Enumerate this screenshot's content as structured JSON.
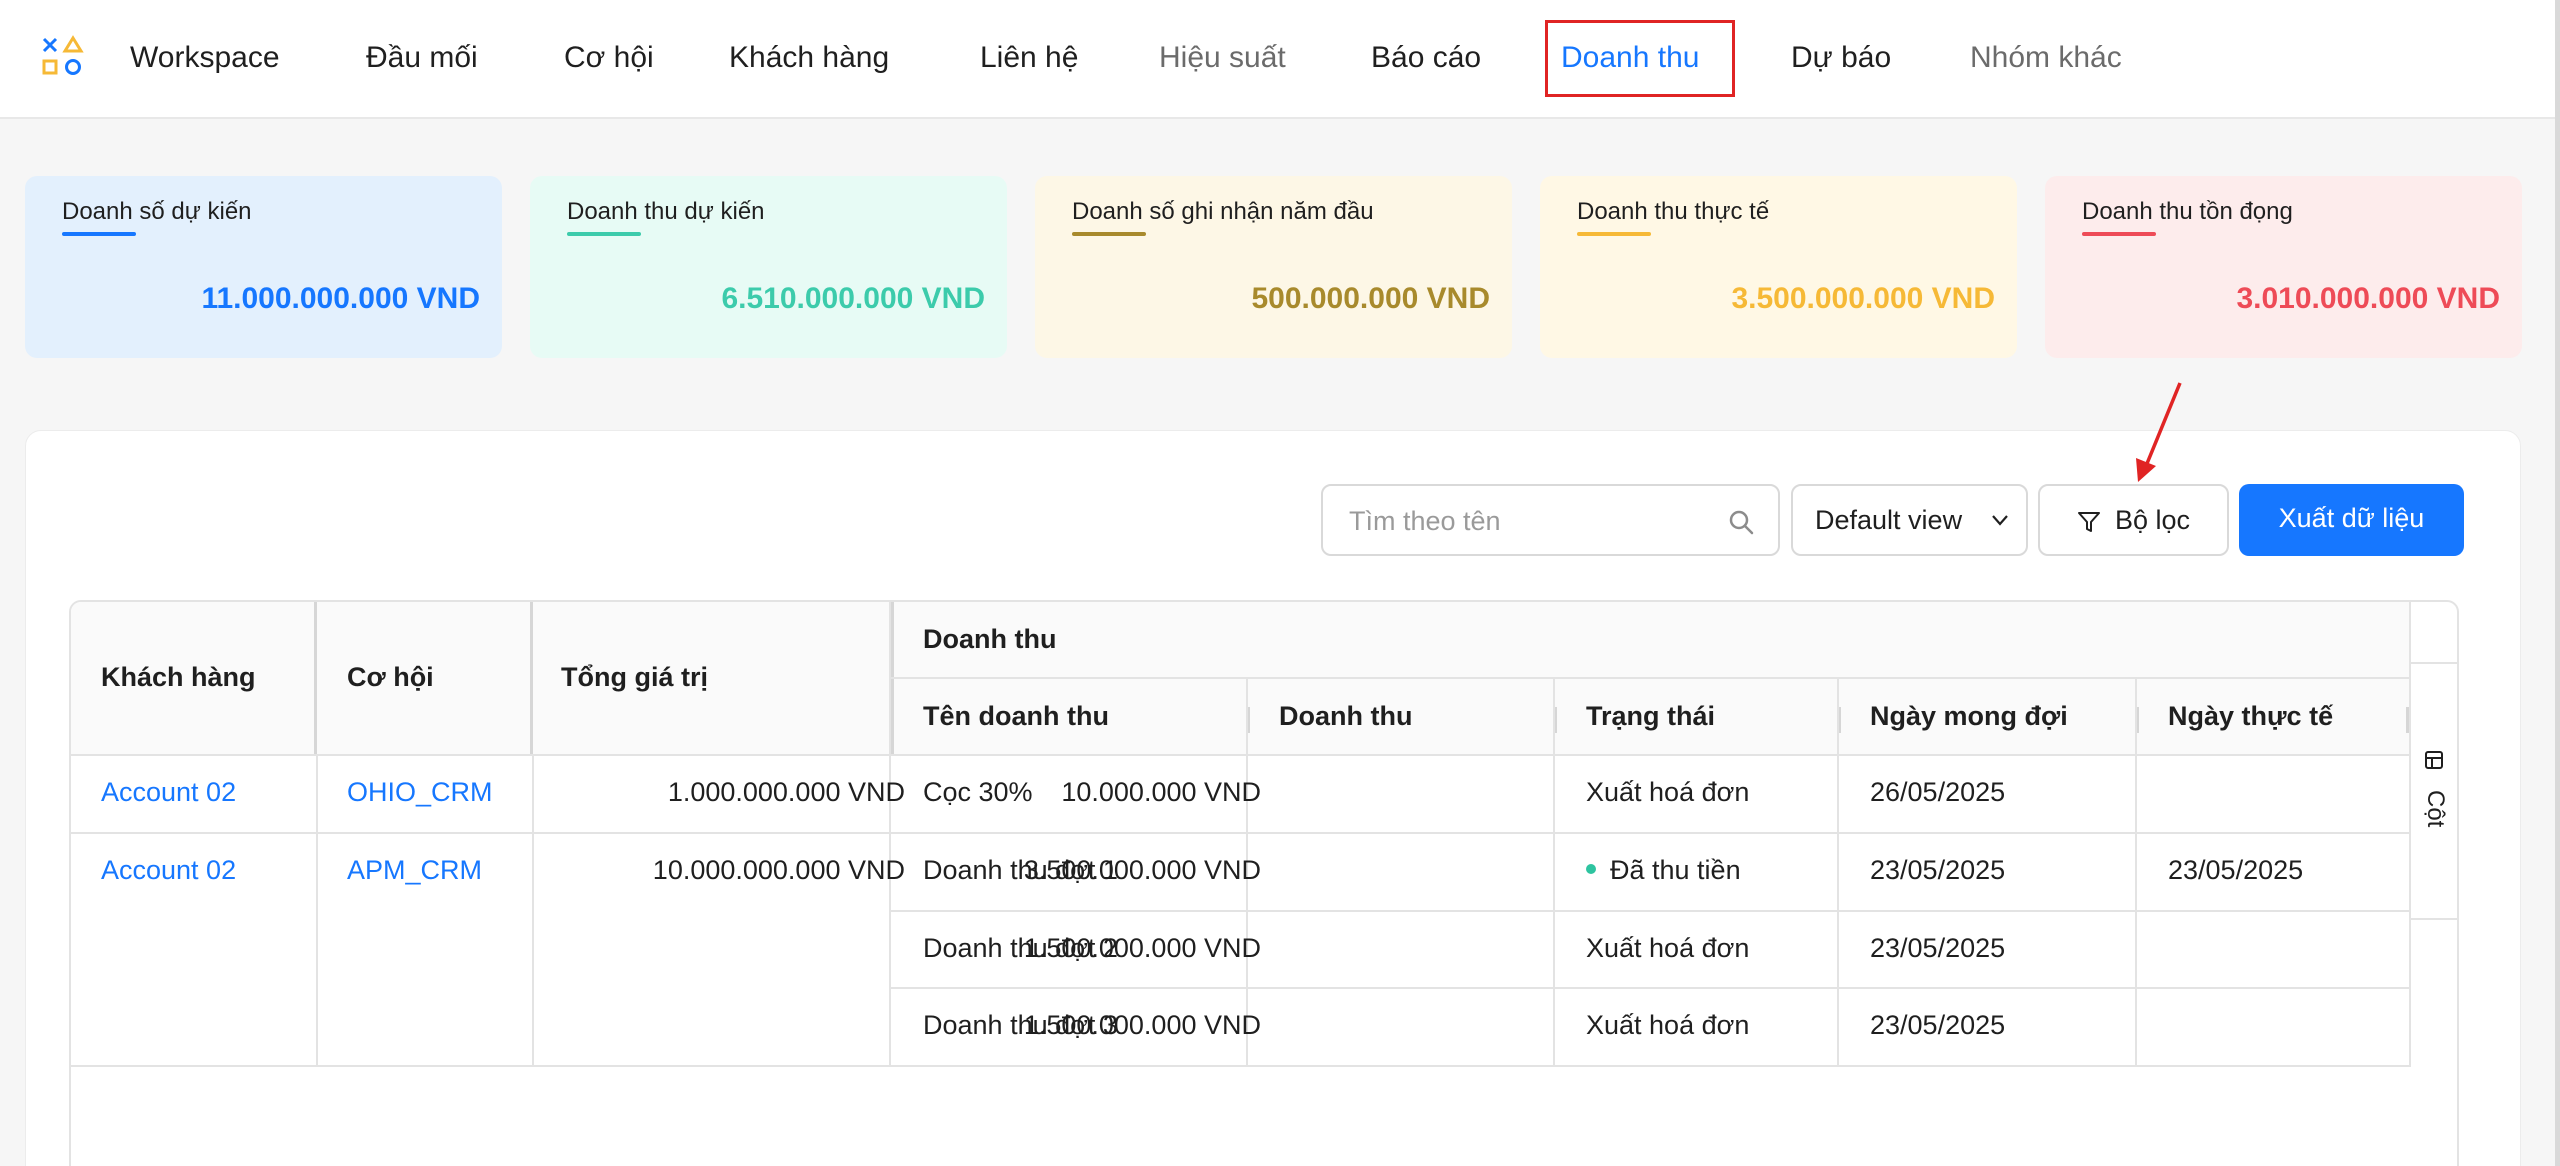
{
  "nav": {
    "items": [
      {
        "label": "Workspace"
      },
      {
        "label": "Đầu mối"
      },
      {
        "label": "Cơ hội"
      },
      {
        "label": "Khách hàng"
      },
      {
        "label": "Liên hệ"
      },
      {
        "label": "Hiệu suất"
      },
      {
        "label": "Báo cáo"
      },
      {
        "label": "Doanh thu"
      },
      {
        "label": "Dự báo"
      },
      {
        "label": "Nhóm khác"
      }
    ],
    "active_label": "Doanh thu"
  },
  "summary": [
    {
      "title": "Doanh số dự kiến",
      "value": "11.000.000.000 VND",
      "color": "#1677ff",
      "bg": "#e3f0fd"
    },
    {
      "title": "Doanh thu dự kiến",
      "value": "6.510.000.000 VND",
      "color": "#3ccbab",
      "bg": "#e7fbf5"
    },
    {
      "title": "Doanh số ghi nhận năm đầu",
      "value": "500.000.000 VND",
      "color": "#a88a2c",
      "bg": "#fdf7e6"
    },
    {
      "title": "Doanh thu thực tế",
      "value": "3.500.000.000 VND",
      "color": "#f6b936",
      "bg": "#fff8e5"
    },
    {
      "title": "Doanh thu tồn đọng",
      "value": "3.010.000.000 VND",
      "color": "#ee4b57",
      "bg": "#fdecec"
    }
  ],
  "toolbar": {
    "search_placeholder": "Tìm theo tên",
    "view_label": "Default view",
    "filter_label": "Bộ lọc",
    "export_label": "Xuất dữ liệu"
  },
  "table": {
    "headers": {
      "customer": "Khách hàng",
      "opportunity": "Cơ hội",
      "total": "Tổng giá trị",
      "group": "Doanh thu",
      "rev_name": "Tên doanh thu",
      "rev_amount": "Doanh thu",
      "status": "Trạng thái",
      "expected_date": "Ngày mong đợi",
      "actual_date": "Ngày thực tế"
    },
    "groups": [
      {
        "customer": "Account 02",
        "opportunity": "OHIO_CRM",
        "total": "1.000.000.000 VND",
        "rows": [
          {
            "name": "Cọc 30%",
            "amount": "10.000.000 VND",
            "status": "Xuất hoá đơn",
            "expected": "26/05/2025",
            "actual": ""
          }
        ]
      },
      {
        "customer": "Account 02",
        "opportunity": "APM_CRM",
        "total": "10.000.000.000 VND",
        "rows": [
          {
            "name": "Doanh thu đợt 1",
            "amount": "3.500.000.000 VND",
            "status": "Đã thu tiền",
            "expected": "23/05/2025",
            "actual": "23/05/2025"
          },
          {
            "name": "Doanh thu đợt 2",
            "amount": "1.500.000.000 VND",
            "status": "Xuất hoá đơn",
            "expected": "23/05/2025",
            "actual": ""
          },
          {
            "name": "Doanh thu đợt 3",
            "amount": "1.500.000.000 VND",
            "status": "Xuất hoá đơn",
            "expected": "23/05/2025",
            "actual": ""
          }
        ]
      }
    ],
    "column_panel_label": "Cột"
  },
  "icons": {
    "logo": "app-logo-icon",
    "search": "search-icon",
    "chevron": "chevron-down-icon",
    "filter": "filter-icon",
    "columns": "columns-icon",
    "annotation": "arrow-annotation-icon"
  }
}
